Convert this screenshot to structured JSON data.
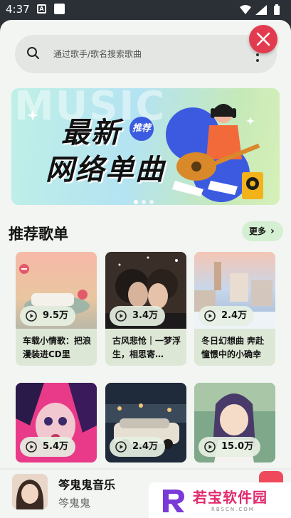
{
  "status": {
    "time": "4:37",
    "a_icon": "A"
  },
  "search": {
    "placeholder": "通过歌手/歌名搜索歌曲"
  },
  "banner": {
    "bg_text": "MUSIC",
    "title_line1": "最新",
    "title_line2": "网络单曲",
    "badge": "推荐",
    "slide_count": 3,
    "active_slide": 0
  },
  "section": {
    "title": "推荐歌单",
    "more_label": "更多"
  },
  "playlists": [
    {
      "plays": "9.5万",
      "title": "车载小情歌：把浪漫装进CD里"
    },
    {
      "plays": "3.4万",
      "title": "古风悲怆｜一梦浮生，相思寄…"
    },
    {
      "plays": "2.4万",
      "title": "冬日幻想曲 奔赴憧憬中的小确幸"
    },
    {
      "plays": "5.4万",
      "title": ""
    },
    {
      "plays": "2.4万",
      "title": ""
    },
    {
      "plays": "15.0万",
      "title": ""
    }
  ],
  "player": {
    "title": "笒鬼鬼音乐",
    "artist": "笒鬼鬼"
  },
  "watermark": {
    "text": "若宝软件园",
    "sub": "RBSCN.COM"
  },
  "colors": {
    "accent": "#e23b4f",
    "green_soft": "#d5efd2",
    "card_bg": "#dde7d6"
  }
}
